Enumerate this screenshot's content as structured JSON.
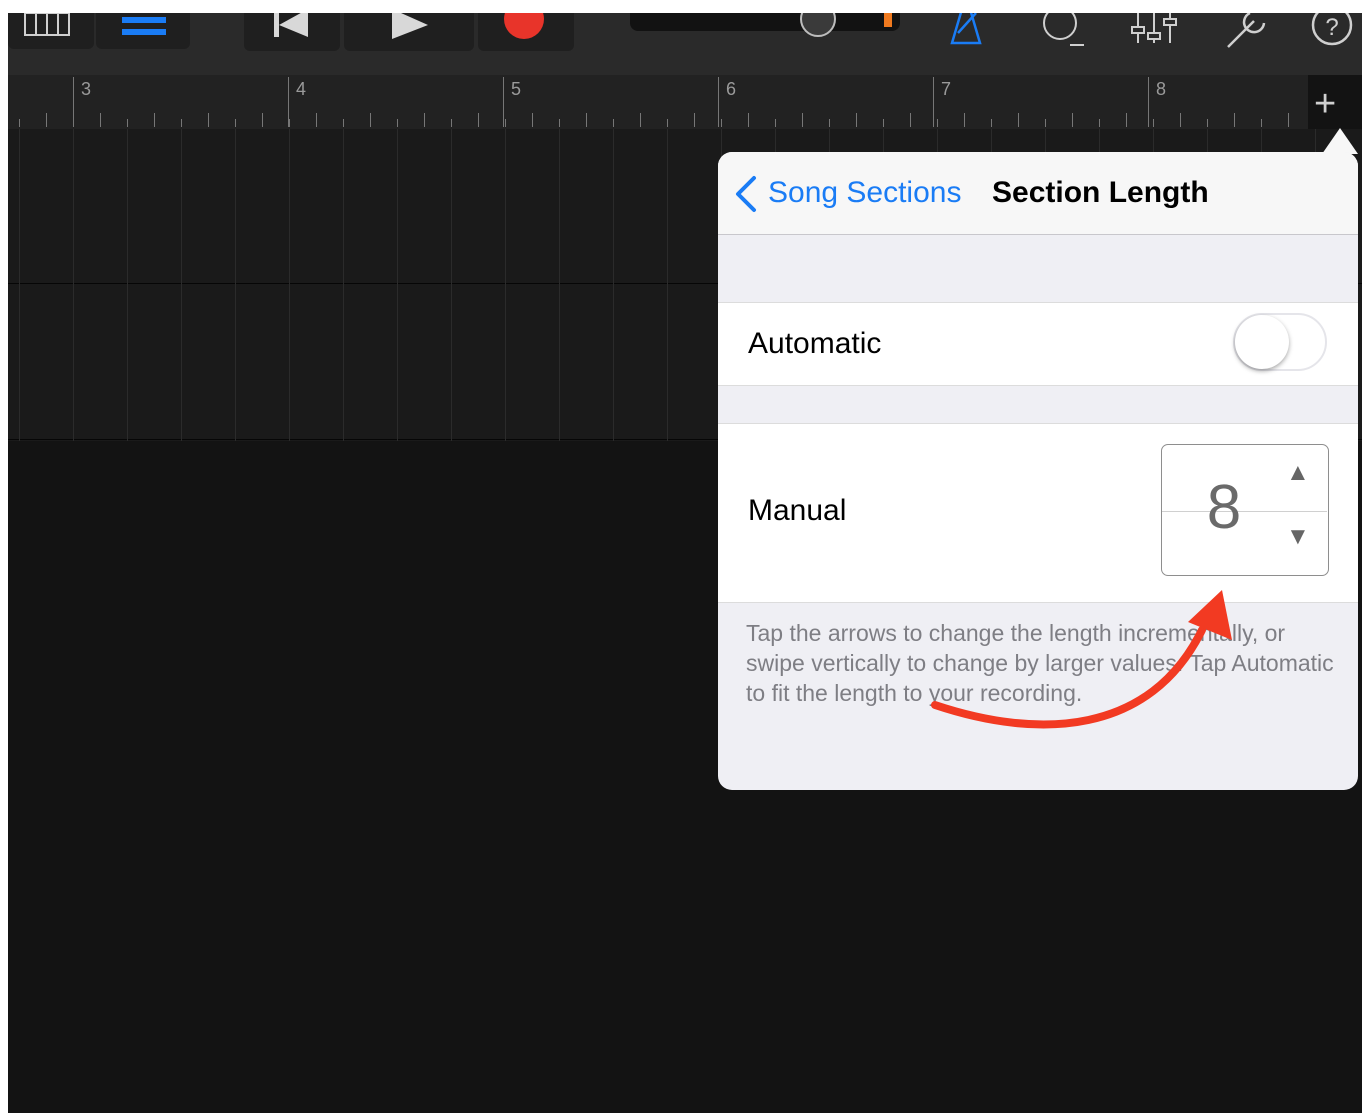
{
  "ruler": {
    "bars": [
      "3",
      "4",
      "5",
      "6",
      "7",
      "8"
    ]
  },
  "toolbar": {
    "icons": [
      "keyboard-icon",
      "tracks-view-icon",
      "rewind-icon",
      "play-icon",
      "record-icon",
      "volume-slider",
      "metronome-icon",
      "loop-icon",
      "mixer-icon",
      "settings-icon",
      "help-icon"
    ],
    "add_button": "+"
  },
  "popover": {
    "back_label": "Song Sections",
    "title": "Section Length",
    "automatic": {
      "label": "Automatic",
      "on": false
    },
    "manual": {
      "label": "Manual",
      "value": "8",
      "up": "▲",
      "down": "▼"
    },
    "help_text": "Tap the arrows to change the length incrementally, or swipe vertically to change by larger values. Tap Automatic to fit the length to your recording."
  },
  "colors": {
    "accent": "#1a7cf5",
    "record": "#e8342a",
    "annotation": "#f23a22"
  }
}
